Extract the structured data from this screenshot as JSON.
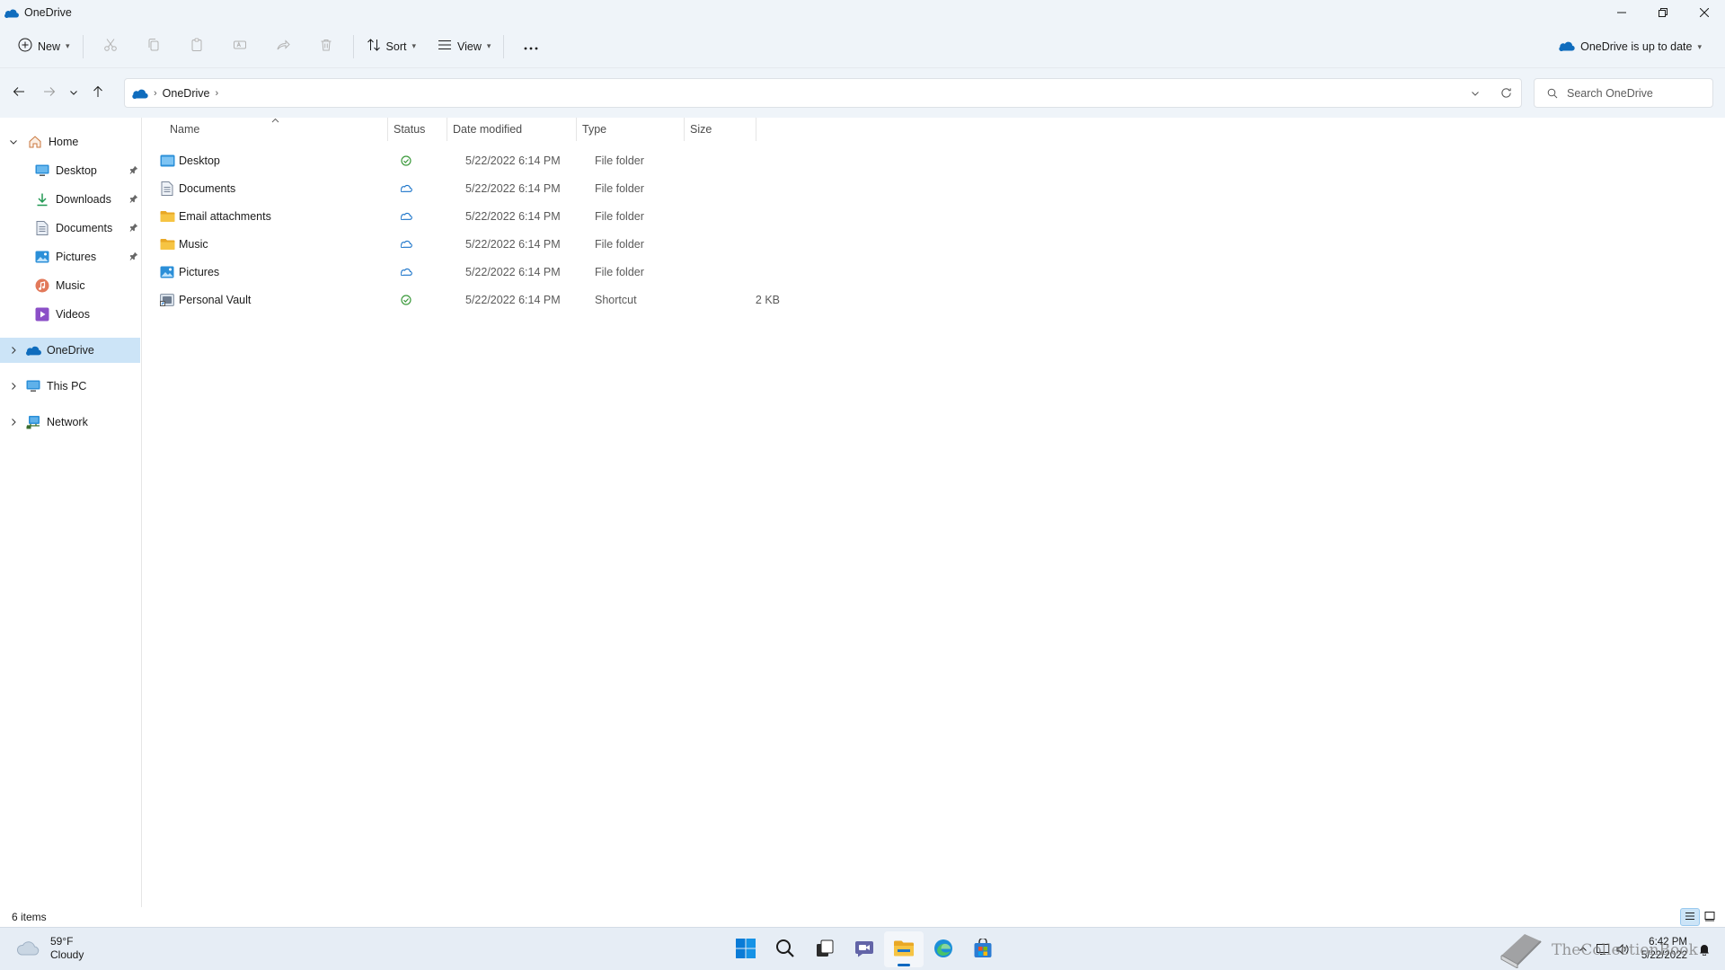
{
  "window": {
    "title": "OneDrive",
    "controls": [
      "minimize",
      "restore",
      "close"
    ]
  },
  "toolbar": {
    "new_label": "New",
    "sort_label": "Sort",
    "view_label": "View",
    "more_label": "···",
    "disabled_actions": [
      "cut",
      "copy",
      "paste",
      "rename",
      "share",
      "delete"
    ],
    "sync_status": "OneDrive is up to date"
  },
  "address": {
    "crumbs": [
      "OneDrive"
    ],
    "search_placeholder": "Search OneDrive"
  },
  "sidebar": {
    "home": "Home",
    "quick_access": [
      {
        "label": "Desktop",
        "icon": "desktop-icon",
        "pinned": true
      },
      {
        "label": "Downloads",
        "icon": "download-icon",
        "pinned": true
      },
      {
        "label": "Documents",
        "icon": "document-icon",
        "pinned": true
      },
      {
        "label": "Pictures",
        "icon": "pictures-icon",
        "pinned": true
      },
      {
        "label": "Music",
        "icon": "music-icon",
        "pinned": false
      },
      {
        "label": "Videos",
        "icon": "videos-icon",
        "pinned": false
      }
    ],
    "onedrive": "OneDrive",
    "this_pc": "This PC",
    "network": "Network"
  },
  "columns": {
    "name": "Name",
    "status": "Status",
    "date": "Date modified",
    "type": "Type",
    "size": "Size"
  },
  "files": [
    {
      "name": "Desktop",
      "icon": "desktop-folder-icon",
      "status": "synced",
      "date": "5/22/2022 6:14 PM",
      "type": "File folder",
      "size": ""
    },
    {
      "name": "Documents",
      "icon": "documents-folder-icon",
      "status": "cloud",
      "date": "5/22/2022 6:14 PM",
      "type": "File folder",
      "size": ""
    },
    {
      "name": "Email attachments",
      "icon": "folder-icon",
      "status": "cloud",
      "date": "5/22/2022 6:14 PM",
      "type": "File folder",
      "size": ""
    },
    {
      "name": "Music",
      "icon": "folder-icon",
      "status": "cloud",
      "date": "5/22/2022 6:14 PM",
      "type": "File folder",
      "size": ""
    },
    {
      "name": "Pictures",
      "icon": "pictures-folder-icon",
      "status": "cloud",
      "date": "5/22/2022 6:14 PM",
      "type": "File folder",
      "size": ""
    },
    {
      "name": "Personal Vault",
      "icon": "shortcut-icon",
      "status": "synced",
      "date": "5/22/2022 6:14 PM",
      "type": "Shortcut",
      "size": "2 KB"
    }
  ],
  "statusbar": {
    "item_count": "6 items"
  },
  "taskbar": {
    "weather_temp": "59°F",
    "weather_desc": "Cloudy",
    "apps": [
      "start",
      "search",
      "task-view",
      "chat",
      "file-explorer",
      "edge",
      "store"
    ],
    "time": "6:42 PM",
    "date": "5/22/2022"
  },
  "watermark": {
    "text": "TheCollectionBook"
  },
  "colors": {
    "chrome": "#eff4f9",
    "selection": "#cce4f7",
    "accent": "#0067c0",
    "synced": "#3c9a3c",
    "cloud": "#1a73c9",
    "folder": "#f6c443"
  }
}
